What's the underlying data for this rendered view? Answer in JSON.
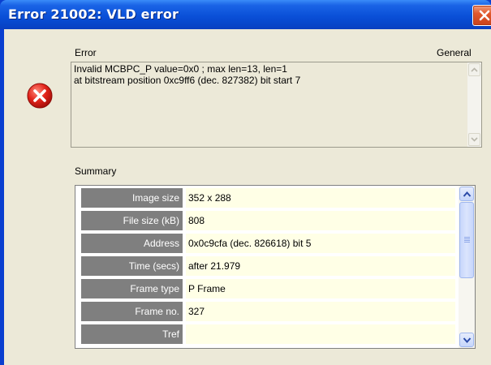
{
  "window": {
    "title": "Error 21002: VLD error",
    "close_icon": "close-icon"
  },
  "error_section": {
    "heading": "Error",
    "category": "General",
    "icon": "error-icon",
    "message_line1": "Invalid MCBPC_P value=0x0 ; max len=13, len=1",
    "message_line2": "at bitstream position 0xc9ff6 (dec. 827382) bit start 7"
  },
  "summary": {
    "heading": "Summary",
    "rows": [
      {
        "label": "Image size",
        "value": "352 x 288"
      },
      {
        "label": "File size (kB)",
        "value": "808"
      },
      {
        "label": "Address",
        "value": "0x0c9cfa (dec. 826618) bit 5"
      },
      {
        "label": "Time (secs)",
        "value": "after 21.979"
      },
      {
        "label": "Frame type",
        "value": "P Frame"
      },
      {
        "label": "Frame no.",
        "value": "327"
      },
      {
        "label": "Tref",
        "value": ""
      }
    ]
  },
  "colors": {
    "titlebar": "#0a50d8",
    "dialog_bg": "#ece9d8",
    "error_red": "#d42020",
    "label_cell": "#7f7f7f",
    "value_cell": "#ffffe6"
  }
}
